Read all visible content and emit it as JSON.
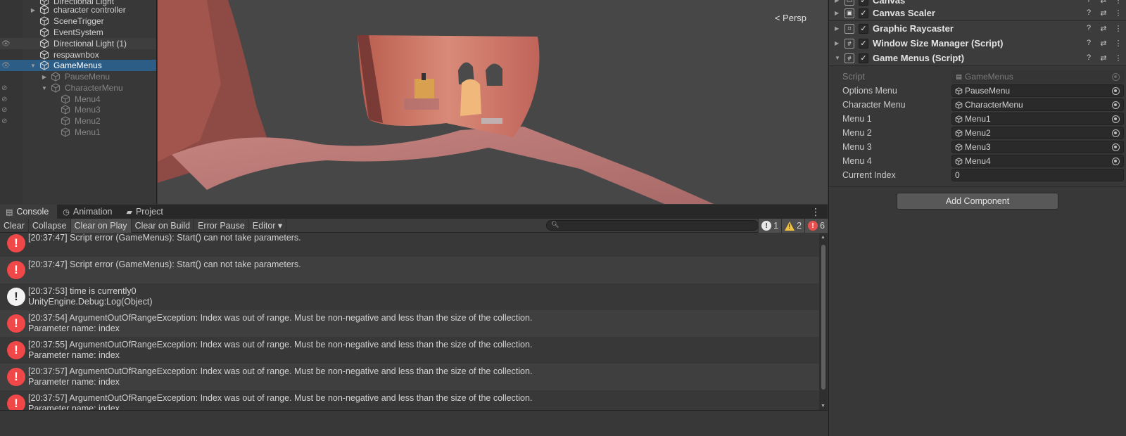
{
  "hierarchy": {
    "items": [
      {
        "label": "Directional Light",
        "indent": 0,
        "fold": "",
        "dim": false
      },
      {
        "label": "character controller",
        "indent": 0,
        "fold": "▶",
        "dim": false
      },
      {
        "label": "SceneTrigger",
        "indent": 0,
        "fold": "",
        "dim": false
      },
      {
        "label": "EventSystem",
        "indent": 0,
        "fold": "",
        "dim": false
      },
      {
        "label": "Directional Light (1)",
        "indent": 0,
        "fold": "",
        "dim": false
      },
      {
        "label": "respawnbox",
        "indent": 0,
        "fold": "",
        "dim": false
      },
      {
        "label": "GameMenus",
        "indent": 0,
        "fold": "▼",
        "dim": false
      },
      {
        "label": "PauseMenu",
        "indent": 1,
        "fold": "▶",
        "dim": true
      },
      {
        "label": "CharacterMenu",
        "indent": 1,
        "fold": "▼",
        "dim": true
      },
      {
        "label": "Menu4",
        "indent": 2,
        "fold": "",
        "dim": true
      },
      {
        "label": "Menu3",
        "indent": 2,
        "fold": "",
        "dim": true
      },
      {
        "label": "Menu2",
        "indent": 2,
        "fold": "",
        "dim": true
      },
      {
        "label": "Menu1",
        "indent": 2,
        "fold": "",
        "dim": true
      }
    ]
  },
  "scene": {
    "persp_label": "Persp",
    "persp_icon": "gizmo-arrow-icon"
  },
  "inspector": {
    "components": [
      {
        "name": "Canvas",
        "icon": "canvas-icon",
        "expanded": false
      },
      {
        "name": "Canvas Scaler",
        "icon": "canvas-scaler-icon",
        "expanded": false
      },
      {
        "name": "Graphic Raycaster",
        "icon": "raycaster-icon",
        "expanded": false
      },
      {
        "name": "Window Size Manager (Script)",
        "icon": "script-hash-icon",
        "expanded": false
      },
      {
        "name": "Game Menus (Script)",
        "icon": "script-hash-icon",
        "expanded": true
      }
    ],
    "properties": [
      {
        "label": "Script",
        "value": "GameMenus",
        "disabled": true
      },
      {
        "label": "Options Menu",
        "value": "PauseMenu",
        "disabled": false
      },
      {
        "label": "Character Menu",
        "value": "CharacterMenu",
        "disabled": false
      },
      {
        "label": "Menu 1",
        "value": "Menu1",
        "disabled": false
      },
      {
        "label": "Menu 2",
        "value": "Menu2",
        "disabled": false
      },
      {
        "label": "Menu 3",
        "value": "Menu3",
        "disabled": false
      },
      {
        "label": "Menu 4",
        "value": "Menu4",
        "disabled": false
      }
    ],
    "current_index_label": "Current Index",
    "current_index_value": "0",
    "add_component_label": "Add Component"
  },
  "tabs": [
    {
      "label": "Console",
      "icon": "console-icon",
      "active": true
    },
    {
      "label": "Animation",
      "icon": "animation-clock-icon",
      "active": false
    },
    {
      "label": "Project",
      "icon": "folder-icon",
      "active": false
    }
  ],
  "console": {
    "toolbar": [
      {
        "label": "Clear",
        "on": false
      },
      {
        "label": "Collapse",
        "on": false
      },
      {
        "label": "Clear on Play",
        "on": true
      },
      {
        "label": "Clear on Build",
        "on": false
      },
      {
        "label": "Error Pause",
        "on": false
      },
      {
        "label": "Editor ▾",
        "on": false
      }
    ],
    "search_placeholder": "",
    "info_count": "1",
    "warning_count": "2",
    "error_count": "6",
    "entries": [
      {
        "type": "error",
        "line1": "[20:37:47] Script error (GameMenus): Start() can not take parameters.",
        "line2": ""
      },
      {
        "type": "error",
        "line1": "[20:37:47] Script error (GameMenus): Start() can not take parameters.",
        "line2": ""
      },
      {
        "type": "info",
        "line1": "[20:37:53] time is currently0",
        "line2": "UnityEngine.Debug:Log(Object)"
      },
      {
        "type": "error",
        "line1": "[20:37:54] ArgumentOutOfRangeException: Index was out of range. Must be non-negative and less than the size of the collection.",
        "line2": "Parameter name: index"
      },
      {
        "type": "error",
        "line1": "[20:37:55] ArgumentOutOfRangeException: Index was out of range. Must be non-negative and less than the size of the collection.",
        "line2": "Parameter name: index"
      },
      {
        "type": "error",
        "line1": "[20:37:57] ArgumentOutOfRangeException: Index was out of range. Must be non-negative and less than the size of the collection.",
        "line2": "Parameter name: index"
      },
      {
        "type": "error",
        "line1": "[20:37:57] ArgumentOutOfRangeException: Index was out of range. Must be non-negative and less than the size of the collection.",
        "line2": "Parameter name: index"
      }
    ]
  },
  "colors": {
    "selection": "#2c5d87",
    "error": "#f04848",
    "warning": "#f0c040",
    "panel": "#383838"
  }
}
